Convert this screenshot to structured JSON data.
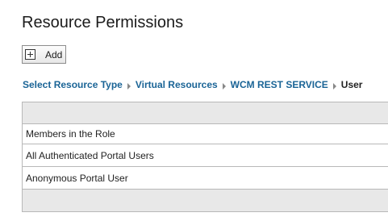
{
  "page": {
    "title": "Resource Permissions"
  },
  "toolbar": {
    "add_label": "Add",
    "add_icon": "plus-box-icon"
  },
  "breadcrumb": {
    "items": [
      "Select Resource Type",
      "Virtual Resources",
      "WCM REST SERVICE"
    ],
    "current": "User",
    "separator_icon": "chevron-right-icon"
  },
  "table": {
    "column_header": "Members in the Role",
    "rows": [
      "All Authenticated Portal Users",
      "Anonymous Portal User"
    ]
  },
  "colors": {
    "link": "#1a6496",
    "bar": "#e8e8e8",
    "border": "#b8b8b8"
  }
}
